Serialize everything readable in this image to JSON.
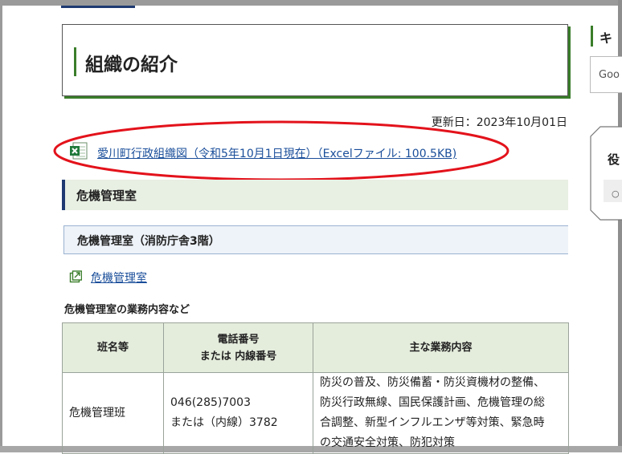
{
  "page": {
    "title": "組織の紹介",
    "updated": "更新日：2023年10月01日"
  },
  "excel_link": {
    "icon": "excel-file-icon",
    "label": "愛川町行政組織図（令和5年10月1日現在）（Excelファイル: 100.5KB)"
  },
  "section": {
    "heading": "危機管理室",
    "subheading": "危機管理室（消防庁舎3階）",
    "external_link": {
      "icon": "external-link-icon",
      "label": "危機管理室"
    },
    "table_caption": "危機管理室の業務内容など"
  },
  "table": {
    "headers": {
      "name": "班名等",
      "phone_line1": "電話番号",
      "phone_line2": "または 内線番号",
      "duties": "主な業務内容"
    },
    "rows": [
      {
        "name": "危機管理班",
        "phone_line1": "046(285)7003",
        "phone_line2": "または（内線）3782",
        "duty_lines": [
          "防災の普及、防災備蓄・防災資機材の整備、",
          "防災行政無線、国民保護計画、危機管理の総",
          "合調整、新型インフルエンザ等対策、緊急時",
          "の交通安全対策、防犯対策"
        ]
      }
    ]
  },
  "sidebar": {
    "heading": "キ",
    "search_placeholder": "Goo",
    "badge_text": "役",
    "badge_small": "○"
  },
  "colors": {
    "accent_green": "#3a7d2a",
    "accent_navy": "#1f3a72",
    "link_blue": "#1a4e9a",
    "annotation_red": "#e3121b"
  }
}
